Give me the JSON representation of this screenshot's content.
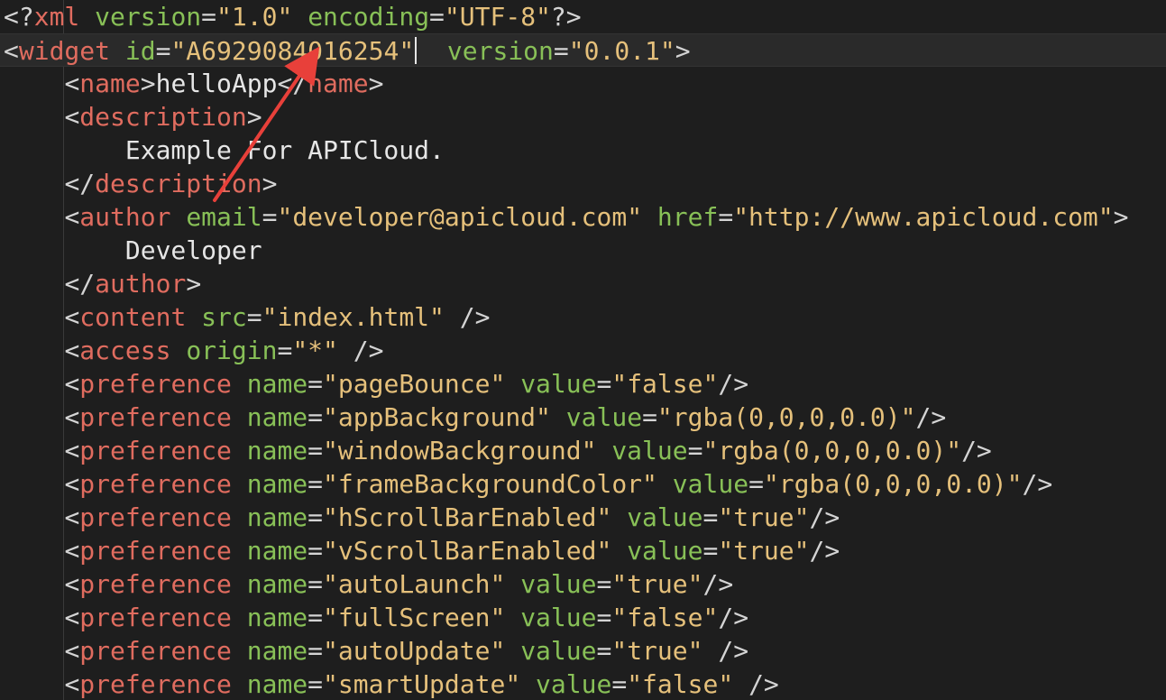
{
  "editor": {
    "colors": {
      "background": "#1e1e1e",
      "tag": "#e06c5f",
      "attribute": "#88c057",
      "string": "#e5c07b",
      "punctuation": "#d4d4d4",
      "annotation_arrow": "#e8403a"
    },
    "active_line": 1,
    "lines": [
      [
        [
          "punct",
          "<?"
        ],
        [
          "xml",
          "xml"
        ],
        [
          "text",
          " "
        ],
        [
          "attr",
          "version"
        ],
        [
          "punct",
          "="
        ],
        [
          "str",
          "\"1.0\""
        ],
        [
          "text",
          " "
        ],
        [
          "attr",
          "encoding"
        ],
        [
          "punct",
          "="
        ],
        [
          "str",
          "\"UTF-8\""
        ],
        [
          "punct",
          "?>"
        ]
      ],
      [
        [
          "punct",
          "<"
        ],
        [
          "tag",
          "widget"
        ],
        [
          "text",
          " "
        ],
        [
          "attr",
          "id"
        ],
        [
          "punct",
          "="
        ],
        [
          "str",
          "\"A6929084016254\""
        ],
        [
          "text",
          "  "
        ],
        [
          "attr",
          "version"
        ],
        [
          "punct",
          "="
        ],
        [
          "str",
          "\"0.0.1\""
        ],
        [
          "punct",
          ">"
        ]
      ],
      [
        [
          "text",
          "    "
        ],
        [
          "punct",
          "<"
        ],
        [
          "tag",
          "name"
        ],
        [
          "punct",
          ">"
        ],
        [
          "text",
          "helloApp"
        ],
        [
          "punct",
          "</"
        ],
        [
          "tag",
          "name"
        ],
        [
          "punct",
          ">"
        ]
      ],
      [
        [
          "text",
          "    "
        ],
        [
          "punct",
          "<"
        ],
        [
          "tag",
          "description"
        ],
        [
          "punct",
          ">"
        ]
      ],
      [
        [
          "text",
          "        Example For APICloud."
        ]
      ],
      [
        [
          "text",
          "    "
        ],
        [
          "punct",
          "</"
        ],
        [
          "tag",
          "description"
        ],
        [
          "punct",
          ">"
        ]
      ],
      [
        [
          "text",
          "    "
        ],
        [
          "punct",
          "<"
        ],
        [
          "tag",
          "author"
        ],
        [
          "text",
          " "
        ],
        [
          "attr",
          "email"
        ],
        [
          "punct",
          "="
        ],
        [
          "str",
          "\"developer@apicloud.com\""
        ],
        [
          "text",
          " "
        ],
        [
          "attr",
          "href"
        ],
        [
          "punct",
          "="
        ],
        [
          "str",
          "\"http://www.apicloud.com\""
        ],
        [
          "punct",
          ">"
        ]
      ],
      [
        [
          "text",
          "        Developer"
        ]
      ],
      [
        [
          "text",
          "    "
        ],
        [
          "punct",
          "</"
        ],
        [
          "tag",
          "author"
        ],
        [
          "punct",
          ">"
        ]
      ],
      [
        [
          "text",
          "    "
        ],
        [
          "punct",
          "<"
        ],
        [
          "tag",
          "content"
        ],
        [
          "text",
          " "
        ],
        [
          "attr",
          "src"
        ],
        [
          "punct",
          "="
        ],
        [
          "str",
          "\"index.html\""
        ],
        [
          "text",
          " "
        ],
        [
          "punct",
          "/>"
        ]
      ],
      [
        [
          "text",
          "    "
        ],
        [
          "punct",
          "<"
        ],
        [
          "tag",
          "access"
        ],
        [
          "text",
          " "
        ],
        [
          "attr",
          "origin"
        ],
        [
          "punct",
          "="
        ],
        [
          "str",
          "\"*\""
        ],
        [
          "text",
          " "
        ],
        [
          "punct",
          "/>"
        ]
      ],
      [
        [
          "text",
          "    "
        ],
        [
          "punct",
          "<"
        ],
        [
          "tag",
          "preference"
        ],
        [
          "text",
          " "
        ],
        [
          "attr",
          "name"
        ],
        [
          "punct",
          "="
        ],
        [
          "str",
          "\"pageBounce\""
        ],
        [
          "text",
          " "
        ],
        [
          "attr",
          "value"
        ],
        [
          "punct",
          "="
        ],
        [
          "str",
          "\"false\""
        ],
        [
          "punct",
          "/>"
        ]
      ],
      [
        [
          "text",
          "    "
        ],
        [
          "punct",
          "<"
        ],
        [
          "tag",
          "preference"
        ],
        [
          "text",
          " "
        ],
        [
          "attr",
          "name"
        ],
        [
          "punct",
          "="
        ],
        [
          "str",
          "\"appBackground\""
        ],
        [
          "text",
          " "
        ],
        [
          "attr",
          "value"
        ],
        [
          "punct",
          "="
        ],
        [
          "str",
          "\"rgba(0,0,0,0.0)\""
        ],
        [
          "punct",
          "/>"
        ]
      ],
      [
        [
          "text",
          "    "
        ],
        [
          "punct",
          "<"
        ],
        [
          "tag",
          "preference"
        ],
        [
          "text",
          " "
        ],
        [
          "attr",
          "name"
        ],
        [
          "punct",
          "="
        ],
        [
          "str",
          "\"windowBackground\""
        ],
        [
          "text",
          " "
        ],
        [
          "attr",
          "value"
        ],
        [
          "punct",
          "="
        ],
        [
          "str",
          "\"rgba(0,0,0,0.0)\""
        ],
        [
          "punct",
          "/>"
        ]
      ],
      [
        [
          "text",
          "    "
        ],
        [
          "punct",
          "<"
        ],
        [
          "tag",
          "preference"
        ],
        [
          "text",
          " "
        ],
        [
          "attr",
          "name"
        ],
        [
          "punct",
          "="
        ],
        [
          "str",
          "\"frameBackgroundColor\""
        ],
        [
          "text",
          " "
        ],
        [
          "attr",
          "value"
        ],
        [
          "punct",
          "="
        ],
        [
          "str",
          "\"rgba(0,0,0,0.0)\""
        ],
        [
          "punct",
          "/>"
        ]
      ],
      [
        [
          "text",
          "    "
        ],
        [
          "punct",
          "<"
        ],
        [
          "tag",
          "preference"
        ],
        [
          "text",
          " "
        ],
        [
          "attr",
          "name"
        ],
        [
          "punct",
          "="
        ],
        [
          "str",
          "\"hScrollBarEnabled\""
        ],
        [
          "text",
          " "
        ],
        [
          "attr",
          "value"
        ],
        [
          "punct",
          "="
        ],
        [
          "str",
          "\"true\""
        ],
        [
          "punct",
          "/>"
        ]
      ],
      [
        [
          "text",
          "    "
        ],
        [
          "punct",
          "<"
        ],
        [
          "tag",
          "preference"
        ],
        [
          "text",
          " "
        ],
        [
          "attr",
          "name"
        ],
        [
          "punct",
          "="
        ],
        [
          "str",
          "\"vScrollBarEnabled\""
        ],
        [
          "text",
          " "
        ],
        [
          "attr",
          "value"
        ],
        [
          "punct",
          "="
        ],
        [
          "str",
          "\"true\""
        ],
        [
          "punct",
          "/>"
        ]
      ],
      [
        [
          "text",
          "    "
        ],
        [
          "punct",
          "<"
        ],
        [
          "tag",
          "preference"
        ],
        [
          "text",
          " "
        ],
        [
          "attr",
          "name"
        ],
        [
          "punct",
          "="
        ],
        [
          "str",
          "\"autoLaunch\""
        ],
        [
          "text",
          " "
        ],
        [
          "attr",
          "value"
        ],
        [
          "punct",
          "="
        ],
        [
          "str",
          "\"true\""
        ],
        [
          "punct",
          "/>"
        ]
      ],
      [
        [
          "text",
          "    "
        ],
        [
          "punct",
          "<"
        ],
        [
          "tag",
          "preference"
        ],
        [
          "text",
          " "
        ],
        [
          "attr",
          "name"
        ],
        [
          "punct",
          "="
        ],
        [
          "str",
          "\"fullScreen\""
        ],
        [
          "text",
          " "
        ],
        [
          "attr",
          "value"
        ],
        [
          "punct",
          "="
        ],
        [
          "str",
          "\"false\""
        ],
        [
          "punct",
          "/>"
        ]
      ],
      [
        [
          "text",
          "    "
        ],
        [
          "punct",
          "<"
        ],
        [
          "tag",
          "preference"
        ],
        [
          "text",
          " "
        ],
        [
          "attr",
          "name"
        ],
        [
          "punct",
          "="
        ],
        [
          "str",
          "\"autoUpdate\""
        ],
        [
          "text",
          " "
        ],
        [
          "attr",
          "value"
        ],
        [
          "punct",
          "="
        ],
        [
          "str",
          "\"true\""
        ],
        [
          "text",
          " "
        ],
        [
          "punct",
          "/>"
        ]
      ],
      [
        [
          "text",
          "    "
        ],
        [
          "punct",
          "<"
        ],
        [
          "tag",
          "preference"
        ],
        [
          "text",
          " "
        ],
        [
          "attr",
          "name"
        ],
        [
          "punct",
          "="
        ],
        [
          "str",
          "\"smartUpdate\""
        ],
        [
          "text",
          " "
        ],
        [
          "attr",
          "value"
        ],
        [
          "punct",
          "="
        ],
        [
          "str",
          "\"false\""
        ],
        [
          "text",
          " "
        ],
        [
          "punct",
          "/>"
        ]
      ]
    ]
  }
}
